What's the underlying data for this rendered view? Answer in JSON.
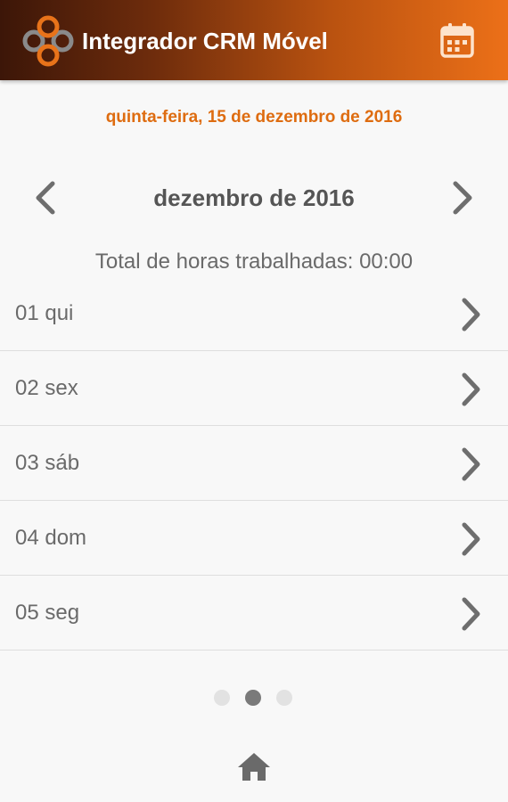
{
  "appbar": {
    "title": "Integrador CRM Móvel",
    "logo_icon": "integrador-logo-icon",
    "calendar_icon": "calendar-icon"
  },
  "current_date": "quinta-feira, 15 de dezembro de 2016",
  "month_nav": {
    "label": "dezembro de 2016",
    "prev_icon": "chevron-left-icon",
    "next_icon": "chevron-right-icon"
  },
  "total_hours": "Total de horas trabalhadas: 00:00",
  "days": [
    {
      "label": "01 qui"
    },
    {
      "label": "02 sex"
    },
    {
      "label": "03 sáb"
    },
    {
      "label": "04 dom"
    },
    {
      "label": "05 seg"
    }
  ],
  "pager": {
    "count": 3,
    "active_index": 1
  },
  "home_icon": "home-icon",
  "colors": {
    "accent": "#de6c10",
    "appbar_start": "#3c1608",
    "appbar_end": "#ec7018",
    "text": "#6a6a6a",
    "background": "#f8f8f8"
  }
}
